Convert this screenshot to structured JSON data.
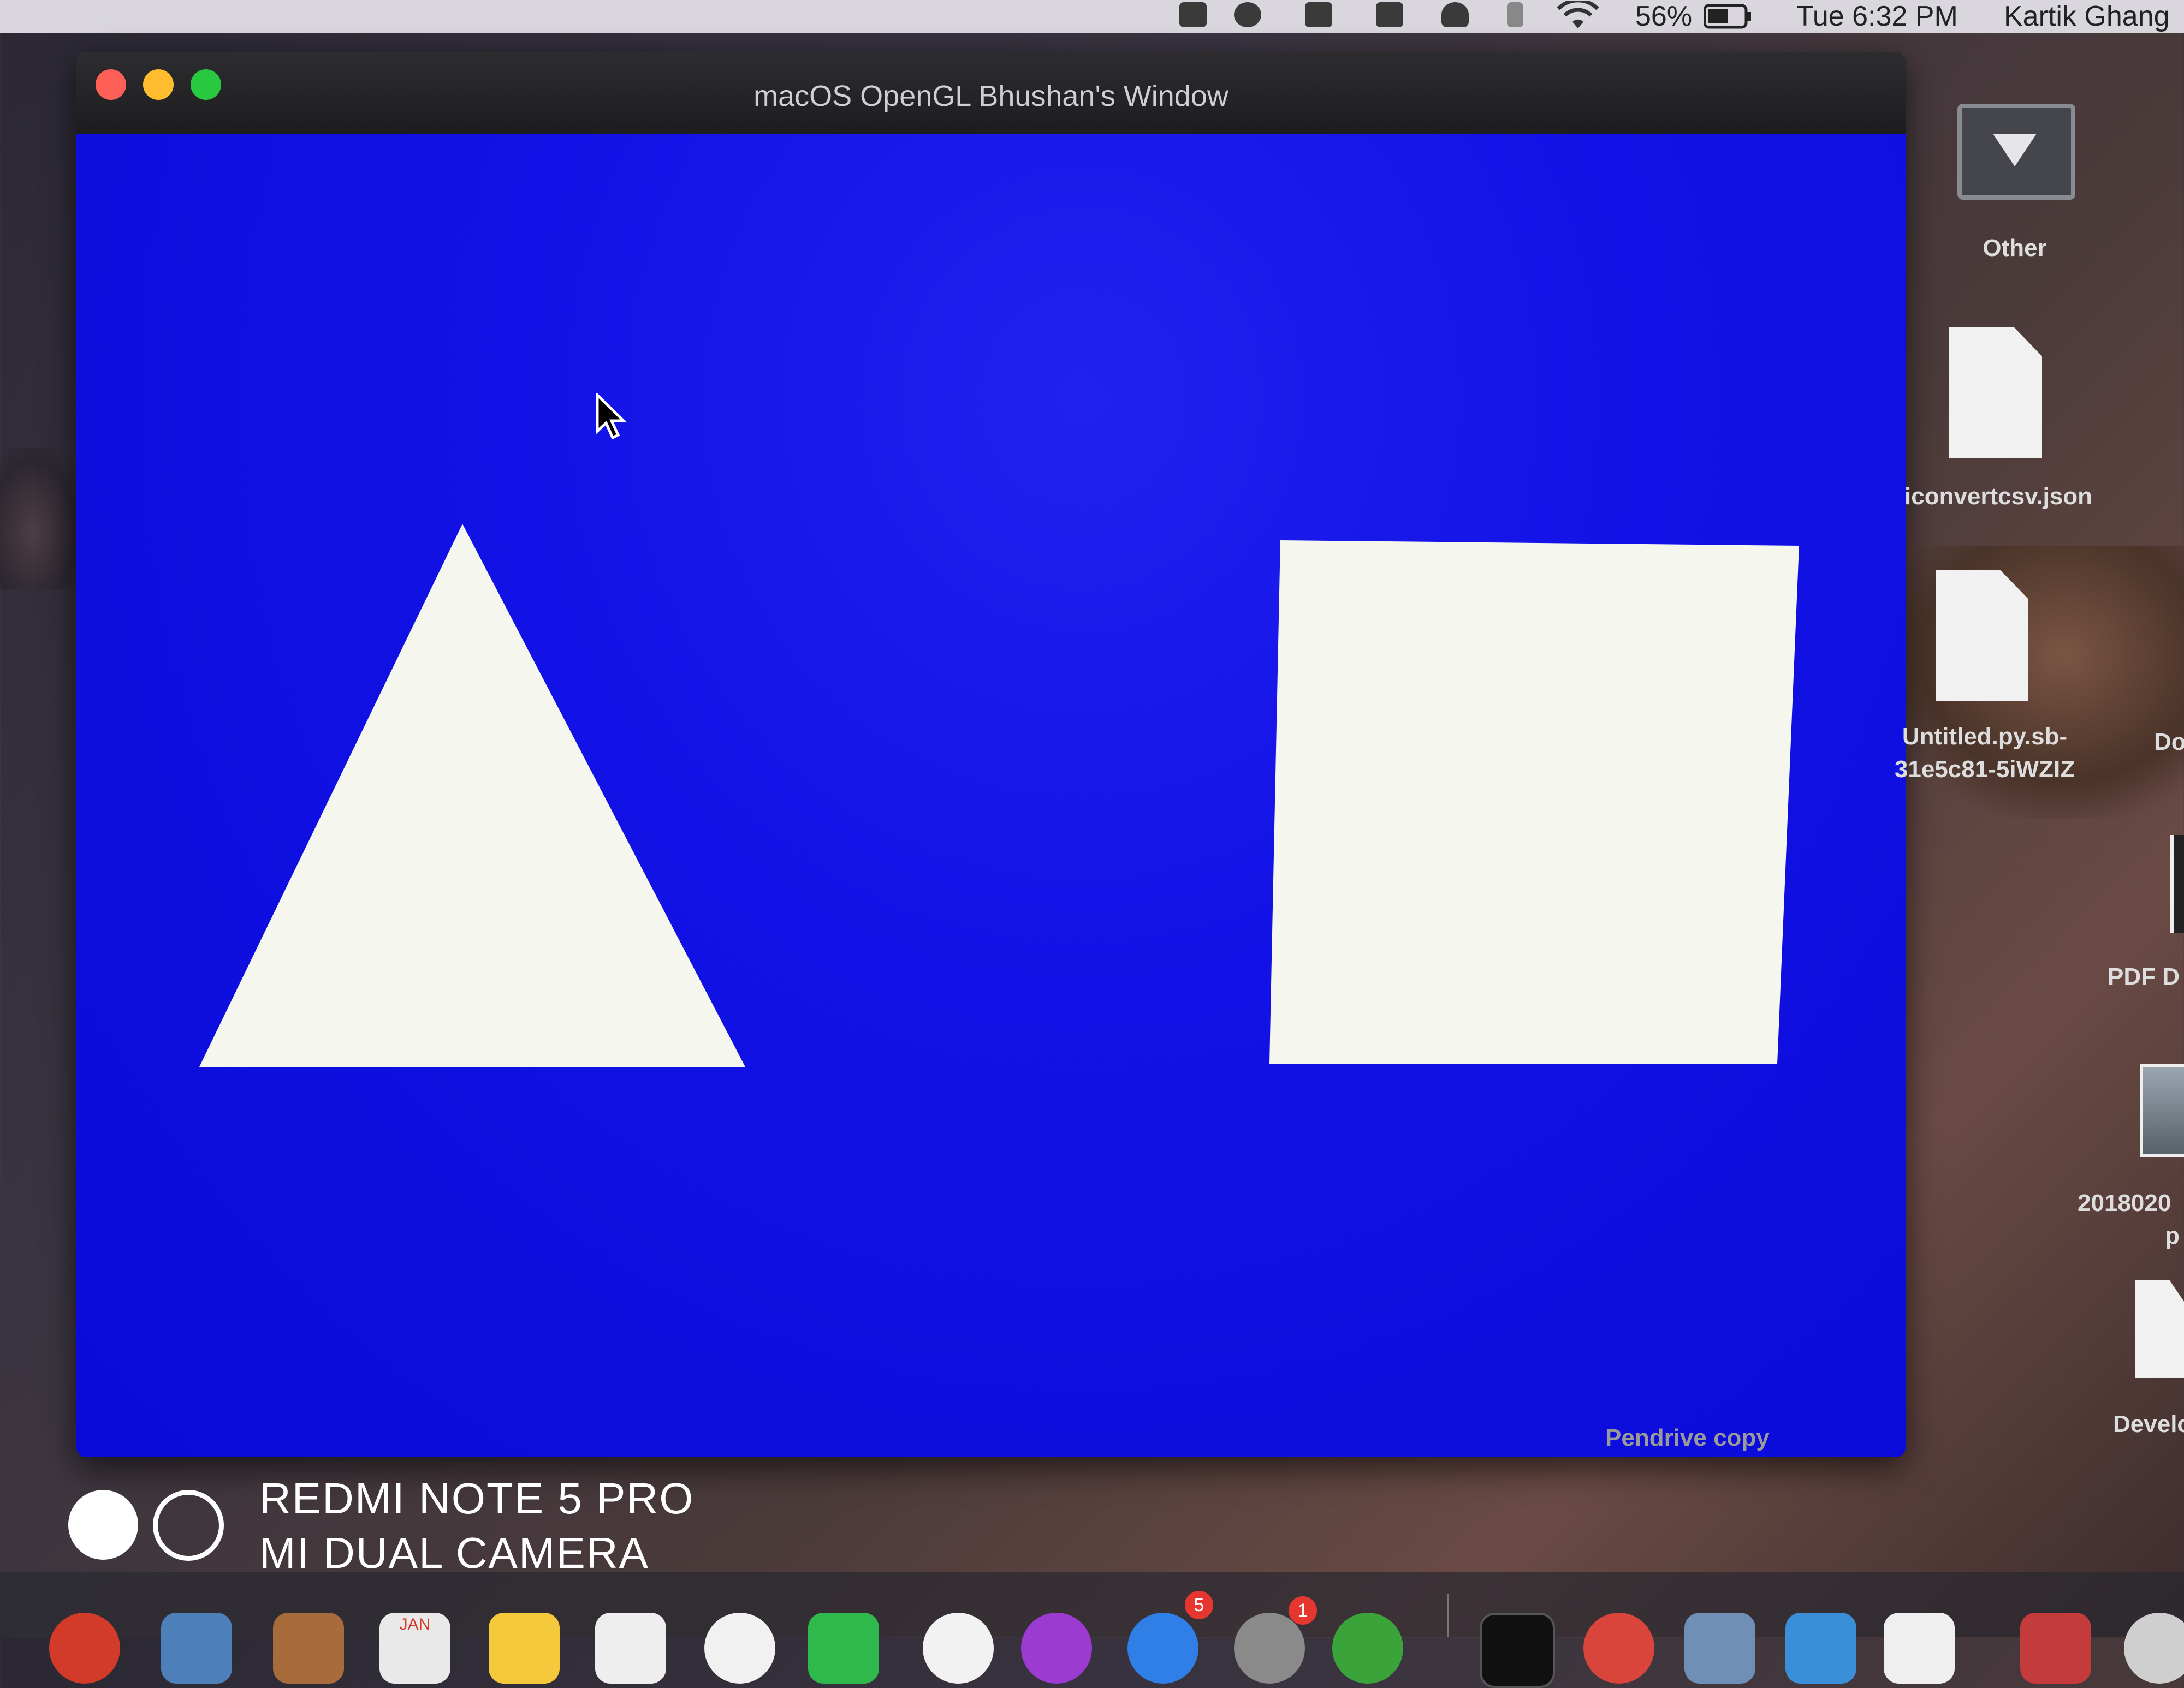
{
  "menubar": {
    "battery": "56%",
    "clock": "Tue 6:32 PM",
    "user": "Kartik Ghang"
  },
  "window": {
    "title": "macOS OpenGL Bhushan's Window",
    "clear_color": "#0f0fe3",
    "shape_color": "#f5f7ef"
  },
  "desktop": {
    "icons": [
      {
        "label": "Other"
      },
      {
        "label": "iconvertcsv.json"
      },
      {
        "label_line1": "Untitled.py.sb-",
        "label_line2": "31e5c81-5iWZIZ"
      },
      {
        "label": "Do"
      },
      {
        "label": "PDF D"
      },
      {
        "label_line1": "2018020",
        "label_line2": "p"
      },
      {
        "label": "Develo"
      }
    ],
    "pendrive_label": "Pendrive copy"
  },
  "watermark": {
    "line1": "REDMI NOTE 5 PRO",
    "line2": "MI DUAL CAMERA"
  },
  "dock": {
    "calendar_month": "JAN",
    "badges": [
      "5",
      "1"
    ]
  }
}
